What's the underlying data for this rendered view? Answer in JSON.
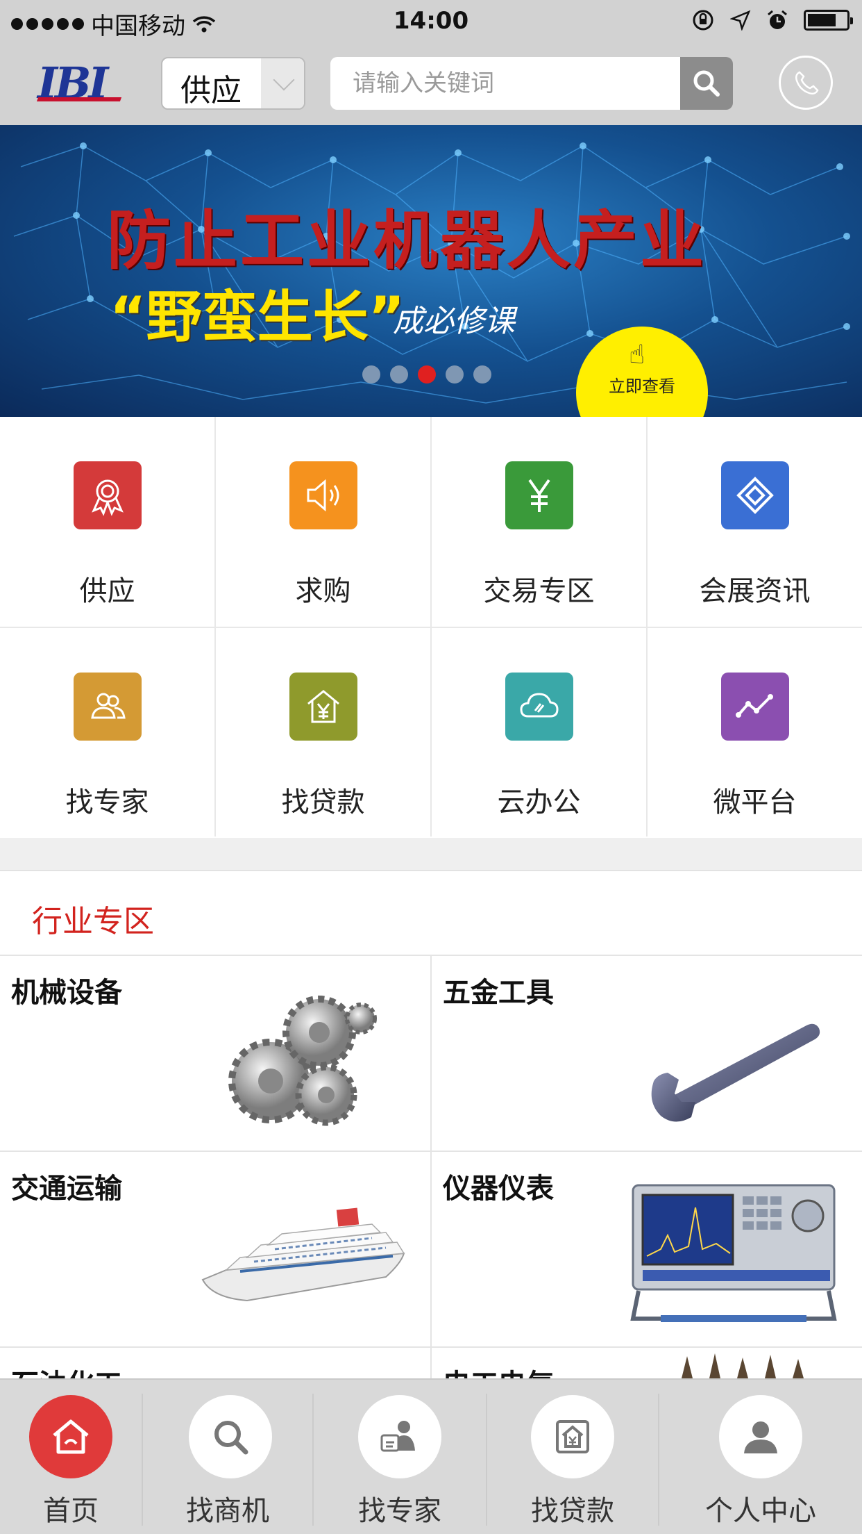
{
  "status_bar": {
    "carrier": "中国移动",
    "time": "14:00"
  },
  "header": {
    "logo_text": "IBI",
    "category_select": "供应",
    "search_placeholder": "请输入关键词"
  },
  "banner": {
    "title": "防止工业机器人产业",
    "subtitle_highlight": "“野蛮生长”",
    "subtitle_rest": "成必修课",
    "cta": "立即查看",
    "dots_total": 5,
    "active_dot": 3
  },
  "quick_menu": [
    {
      "label": "供应",
      "icon": "award-icon",
      "color": "#d43a3a"
    },
    {
      "label": "求购",
      "icon": "speaker-icon",
      "color": "#f5921e"
    },
    {
      "label": "交易专区",
      "icon": "yen-icon",
      "color": "#3a9a3a"
    },
    {
      "label": "会展资讯",
      "icon": "diamond-icon",
      "color": "#3a6fd4"
    },
    {
      "label": "找专家",
      "icon": "people-icon",
      "color": "#d49a34"
    },
    {
      "label": "找贷款",
      "icon": "house-yen-icon",
      "color": "#8f9a2c"
    },
    {
      "label": "云办公",
      "icon": "cloud-icon",
      "color": "#3aa8a8"
    },
    {
      "label": "微平台",
      "icon": "trend-icon",
      "color": "#8b4fb0"
    }
  ],
  "industry": {
    "title": "行业专区",
    "items": [
      {
        "label": "机械设备"
      },
      {
        "label": "五金工具"
      },
      {
        "label": "交通运输"
      },
      {
        "label": "仪器仪表"
      },
      {
        "label": "石油化工"
      },
      {
        "label": "电工电气"
      }
    ]
  },
  "tabbar": [
    {
      "label": "首页",
      "icon": "home-icon",
      "active": true
    },
    {
      "label": "找商机",
      "icon": "search-icon",
      "active": false
    },
    {
      "label": "找专家",
      "icon": "expert-icon",
      "active": false
    },
    {
      "label": "找贷款",
      "icon": "loan-icon",
      "active": false
    },
    {
      "label": "个人中心",
      "icon": "user-icon",
      "active": false
    }
  ]
}
